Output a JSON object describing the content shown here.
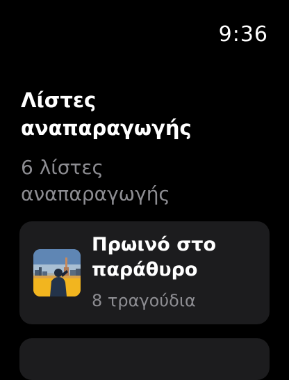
{
  "status_bar": {
    "time": "9:36"
  },
  "header": {
    "title": "Λίστες αναπαραγωγής",
    "subtitle": "6 λίστες αναπαραγωγής"
  },
  "playlists": [
    {
      "title": "Πρωινό στο παράθυρο",
      "count": "8 τραγούδια",
      "artwork_icon": "playlist-artwork-photo"
    }
  ],
  "colors": {
    "background": "#000000",
    "card": "#1c1c1e",
    "secondary_text": "#8d8d92"
  }
}
